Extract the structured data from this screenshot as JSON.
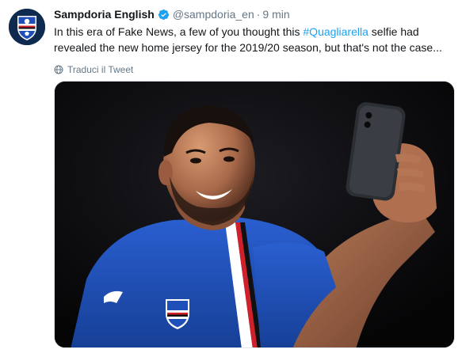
{
  "tweet": {
    "display_name": "Sampdoria English",
    "handle": "@sampdoria_en",
    "separator": "·",
    "time": "9 min",
    "text_before": "In this era of Fake News, a few of you thought this ",
    "hashtag": "#Quagliarella",
    "text_after": " selfie had revealed the new home jersey for the 2019/20 season, but that's not the case...",
    "translate_label": "Traduci il Tweet",
    "verified_icon": "verified-badge-icon",
    "globe_icon": "globe-icon"
  },
  "colors": {
    "link": "#1da1f2",
    "secondary_text": "#657786",
    "primary_text": "#14171a",
    "jersey_blue": "#1f4fb8"
  }
}
